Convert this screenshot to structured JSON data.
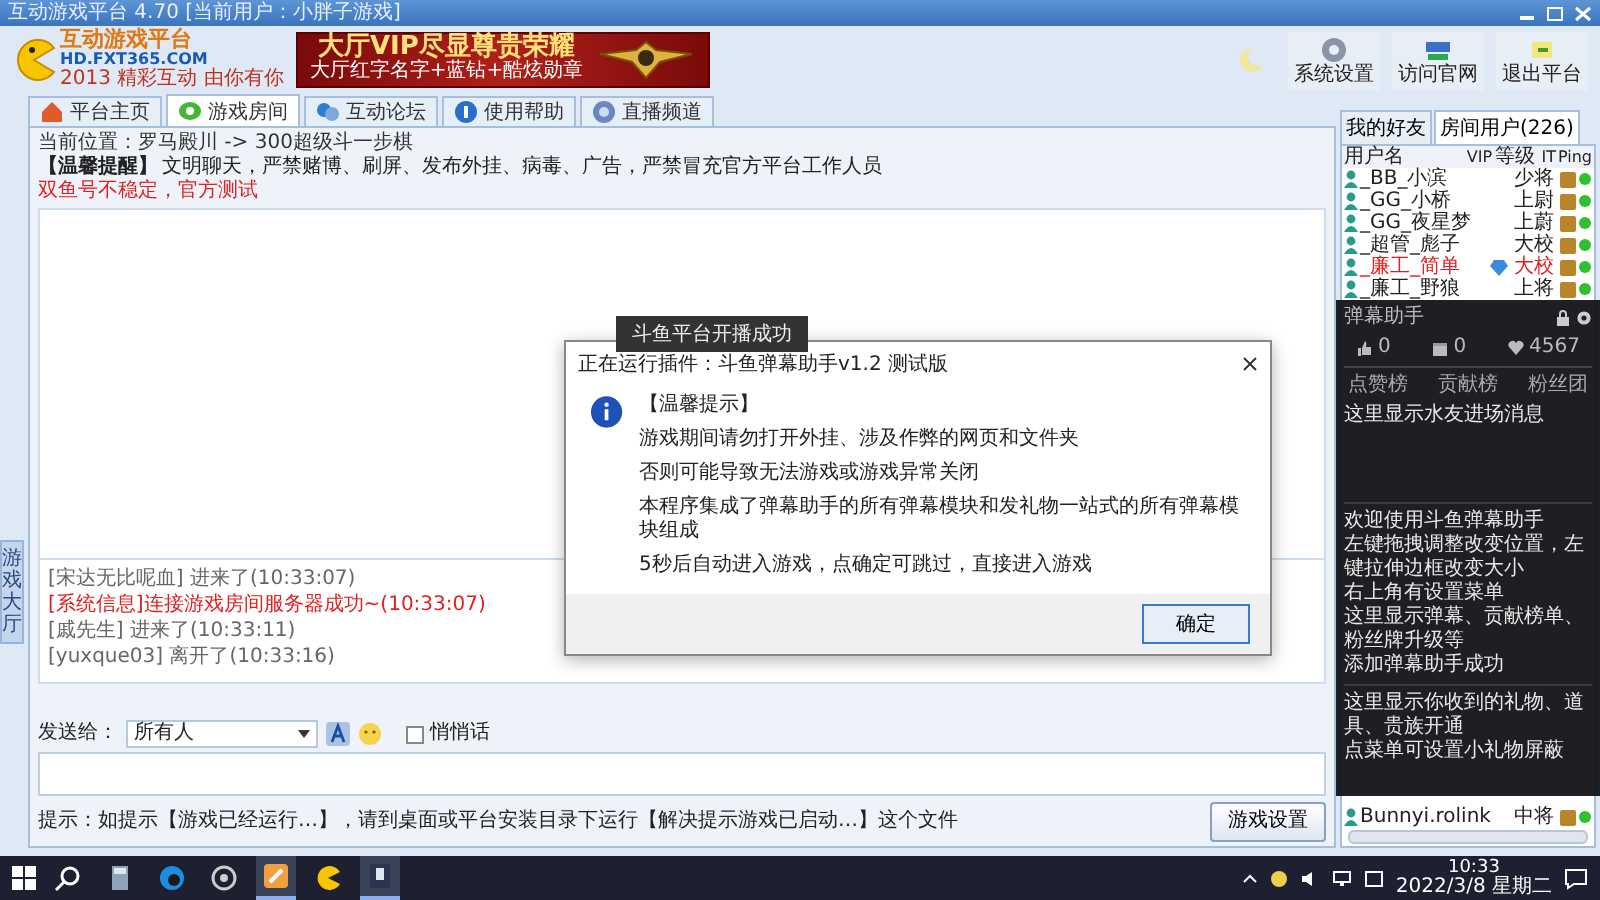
{
  "window": {
    "title": "互动游戏平台 4.70 [当前用户：小胖子游戏]"
  },
  "header": {
    "logo_text": "互动游戏平台",
    "logo_url": "HD.FXT365.COM",
    "logo_slogan": "2013 精彩互动 由你有你",
    "banner_title": "大厅VIP尽显尊贵荣耀",
    "banner_subtitle": "大厅红字名字+蓝钻+酷炫勋章"
  },
  "toolbar": [
    {
      "label": "系统设置",
      "kind": "gear"
    },
    {
      "label": "访问官网",
      "kind": "globe"
    },
    {
      "label": "退出平台",
      "kind": "exit"
    }
  ],
  "tabs": [
    {
      "label": "平台主页",
      "kind": "home",
      "selected": false
    },
    {
      "label": "游戏房间",
      "kind": "chat",
      "selected": true
    },
    {
      "label": "互动论坛",
      "kind": "forum",
      "selected": false
    },
    {
      "label": "使用帮助",
      "kind": "help",
      "selected": false
    },
    {
      "label": "直播频道",
      "kind": "live",
      "selected": false
    }
  ],
  "side_tab": "游戏大厅",
  "location": "当前位置：罗马殿川 -> 300超级斗一步棋",
  "notice": {
    "tag": "【温馨提醒】",
    "text": "文明聊天，严禁赌博、刷屏、发布外挂、病毒、广告，严禁冒充官方平台工作人员"
  },
  "warning": "双鱼号不稳定，官方测试",
  "messages": [
    {
      "text": "[宋达无比呢血] 进来了(10:33:07)",
      "kind": "user"
    },
    {
      "text": "[系统信息]连接游戏房间服务器成功~(10:33:07)",
      "kind": "system"
    },
    {
      "text": "[戚先生] 进来了(10:33:11)",
      "kind": "user"
    },
    {
      "text": "[yuxque03] 离开了(10:33:16)",
      "kind": "user"
    }
  ],
  "send": {
    "label": "发送给：",
    "target": "所有人",
    "whisper": {
      "label": "悄悄话",
      "checked": false
    }
  },
  "hint": "提示：如提示【游戏已经运行…】，请到桌面或平台安装目录下运行【解决提示游戏已启动…】这个文件",
  "buttons": [
    {
      "label": "游戏设置",
      "disabled": false
    }
  ],
  "user_panel": {
    "tabs": [
      {
        "label": "我的好友",
        "selected": false
      },
      {
        "label": "房间用户(226)",
        "selected": true
      }
    ],
    "columns": [
      "用户名",
      "VIP",
      "等级",
      "IT",
      "Ping"
    ],
    "rows": [
      {
        "name": "_BB_小滨",
        "vip": false,
        "level": "少将",
        "highlight": false
      },
      {
        "name": "_GG_小桥",
        "vip": false,
        "level": "上尉",
        "highlight": false
      },
      {
        "name": "_GG_夜星梦",
        "vip": false,
        "level": "上蔚",
        "highlight": false
      },
      {
        "name": "_超管_彪子",
        "vip": false,
        "level": "大校",
        "highlight": false
      },
      {
        "name": "_廉工_简单",
        "vip": true,
        "level": "大校",
        "highlight": true
      },
      {
        "name": "_廉工_野狼",
        "vip": false,
        "level": "上将",
        "highlight": false
      }
    ],
    "bottom_rows": [
      {
        "name": "Bunnyi.rolink",
        "vip": false,
        "level": "中将",
        "highlight": false
      }
    ]
  },
  "toast": "斗鱼平台开播成功",
  "dialog": {
    "title": "正在运行插件：斗鱼弹幕助手v1.2 测试版",
    "heading": "【温馨提示】",
    "lines": [
      "游戏期间请勿打开外挂、涉及作弊的网页和文件夹",
      "否则可能导致无法游戏或游戏异常关闭",
      "本程序集成了弹幕助手的所有弹幕模块和发礼物一站式的所有弹幕模块组成",
      "5秒后自动进入游戏，点确定可跳过，直接进入游戏"
    ],
    "button": "确定"
  },
  "overlay": {
    "title": "弹幕助手",
    "stats": [
      {
        "kind": "thumb",
        "value": "0"
      },
      {
        "kind": "gift",
        "value": "0"
      },
      {
        "kind": "heart",
        "value": "4567"
      }
    ],
    "tabs": [
      "点赞榜",
      "贡献榜",
      "粉丝团"
    ],
    "sections": [
      [
        "这里显示水友进场消息"
      ],
      [
        "欢迎使用斗鱼弹幕助手",
        "左键拖拽调整改变位置，左键拉伸边框改变大小",
        "右上角有设置菜单",
        "这里显示弹幕、贡献榜单、粉丝牌升级等",
        "添加弹幕助手成功"
      ],
      [
        "这里显示你收到的礼物、道具、贵族开通",
        "点菜单可设置小礼物屏蔽"
      ]
    ]
  },
  "taskbar": {
    "apps": [
      {
        "kind": "search",
        "active": false
      },
      {
        "kind": "calculator",
        "active": false
      },
      {
        "kind": "edge",
        "active": false
      },
      {
        "kind": "browser",
        "active": false
      },
      {
        "kind": "tool",
        "active": true
      },
      {
        "kind": "game",
        "active": false
      },
      {
        "kind": "player",
        "active": true
      }
    ],
    "time": "10:33",
    "date": "2022/3/8 星期二"
  }
}
